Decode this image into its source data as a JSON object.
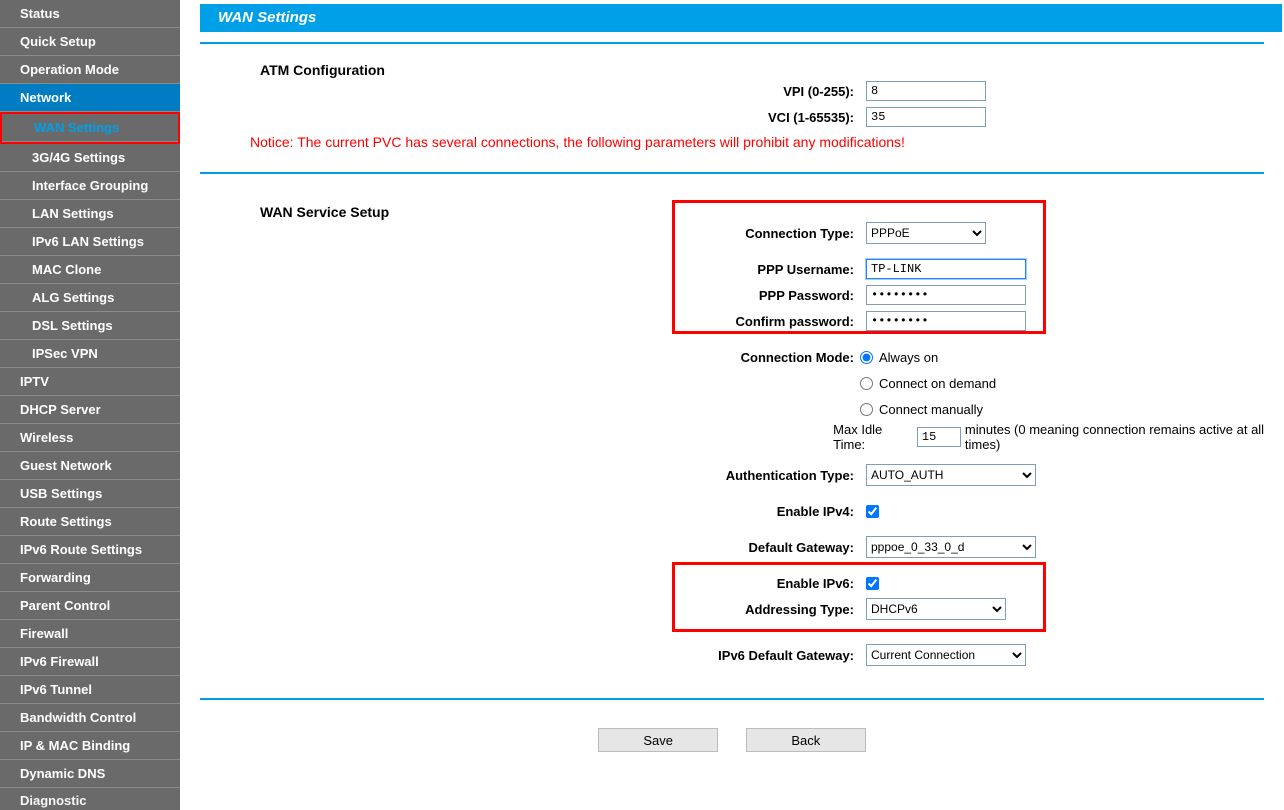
{
  "page": {
    "title": "WAN Settings"
  },
  "sidebar": {
    "items": [
      {
        "label": "Status"
      },
      {
        "label": "Quick Setup"
      },
      {
        "label": "Operation Mode"
      },
      {
        "label": "Network",
        "children": [
          {
            "label": "WAN Settings"
          },
          {
            "label": "3G/4G Settings"
          },
          {
            "label": "Interface Grouping"
          },
          {
            "label": "LAN Settings"
          },
          {
            "label": "IPv6 LAN Settings"
          },
          {
            "label": "MAC Clone"
          },
          {
            "label": "ALG Settings"
          },
          {
            "label": "DSL Settings"
          },
          {
            "label": "IPSec VPN"
          }
        ]
      },
      {
        "label": "IPTV"
      },
      {
        "label": "DHCP Server"
      },
      {
        "label": "Wireless"
      },
      {
        "label": "Guest Network"
      },
      {
        "label": "USB Settings"
      },
      {
        "label": "Route Settings"
      },
      {
        "label": "IPv6 Route Settings"
      },
      {
        "label": "Forwarding"
      },
      {
        "label": "Parent Control"
      },
      {
        "label": "Firewall"
      },
      {
        "label": "IPv6 Firewall"
      },
      {
        "label": "IPv6 Tunnel"
      },
      {
        "label": "Bandwidth Control"
      },
      {
        "label": "IP & MAC Binding"
      },
      {
        "label": "Dynamic DNS"
      },
      {
        "label": "Diagnostic"
      }
    ]
  },
  "atm": {
    "section_title": "ATM Configuration",
    "vpi_label": "VPI (0-255):",
    "vpi_value": "8",
    "vci_label": "VCI (1-65535):",
    "vci_value": "35",
    "notice": "Notice: The current PVC has several connections, the following parameters will prohibit any modifications!"
  },
  "wan": {
    "section_title": "WAN Service Setup",
    "conn_type_label": "Connection Type:",
    "conn_type_value": "PPPoE",
    "ppp_user_label": "PPP Username:",
    "ppp_user_value": "TP-LINK",
    "ppp_pass_label": "PPP Password:",
    "ppp_pass_value": "••••••••",
    "ppp_conf_label": "Confirm password:",
    "ppp_conf_value": "••••••••",
    "conn_mode_label": "Connection Mode:",
    "conn_mode_opts": {
      "always": "Always on",
      "demand": "Connect on demand",
      "manual": "Connect manually"
    },
    "idle_label_pre": "Max Idle Time:",
    "idle_value": "15",
    "idle_label_post": "minutes (0 meaning connection remains active at all times)",
    "auth_label": "Authentication Type:",
    "auth_value": "AUTO_AUTH",
    "enable_ipv4_label": "Enable IPv4:",
    "def_gw_label": "Default Gateway:",
    "def_gw_value": "pppoe_0_33_0_d",
    "enable_ipv6_label": "Enable IPv6:",
    "addr_type_label": "Addressing Type:",
    "addr_type_value": "DHCPv6",
    "ipv6_gw_label": "IPv6 Default Gateway:",
    "ipv6_gw_value": "Current Connection"
  },
  "buttons": {
    "save": "Save",
    "back": "Back"
  }
}
